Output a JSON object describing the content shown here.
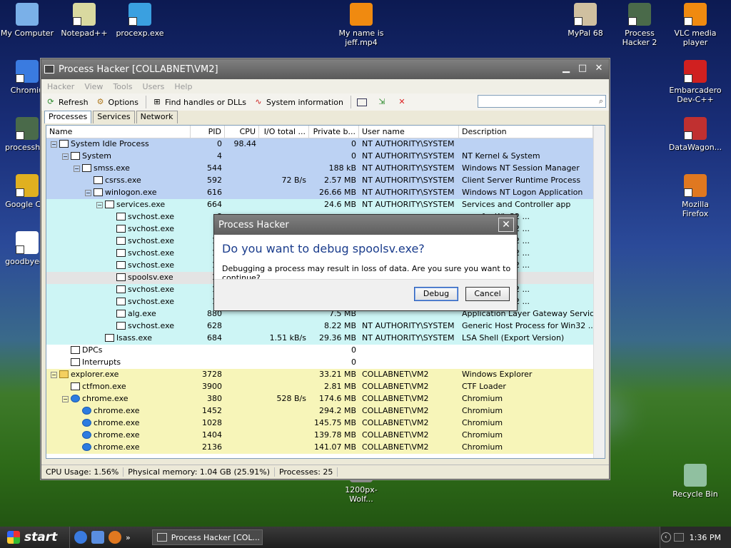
{
  "desktop_icons": [
    {
      "label": "My Computer",
      "icon": "computer-icon"
    },
    {
      "label": "Notepad++",
      "icon": "notepad-icon"
    },
    {
      "label": "procexp.exe",
      "icon": "procexp-icon"
    },
    {
      "label": "My name is jeff.mp4",
      "icon": "vlc-file-icon"
    },
    {
      "label": "MyPal 68",
      "icon": "mypal-icon"
    },
    {
      "label": "Process Hacker 2",
      "icon": "process-hacker-icon"
    },
    {
      "label": "VLC media player",
      "icon": "vlc-icon"
    },
    {
      "label": "Chromiu",
      "icon": "chromium-icon"
    },
    {
      "label": "Embarcadero Dev-C++",
      "icon": "devcpp-icon"
    },
    {
      "label": "processhac",
      "icon": "process-hacker-icon"
    },
    {
      "label": "DataWagon...",
      "icon": "datawagon-icon"
    },
    {
      "label": "Google Chr",
      "icon": "chrome-icon"
    },
    {
      "label": "Mozilla Firefox",
      "icon": "firefox-icon"
    },
    {
      "label": "goodbyedp",
      "icon": "file-icon"
    },
    {
      "label": "1200px-Wolf...",
      "icon": "image-icon"
    },
    {
      "label": "Recycle Bin",
      "icon": "recycle-bin-icon"
    }
  ],
  "window": {
    "title": "Process Hacker [COLLABNET\\VM2]",
    "menu": [
      "Hacker",
      "View",
      "Tools",
      "Users",
      "Help"
    ],
    "toolbar": {
      "refresh": "Refresh",
      "options": "Options",
      "find": "Find handles or DLLs",
      "sysinfo": "System information"
    },
    "tabs": [
      "Processes",
      "Services",
      "Network"
    ],
    "columns": [
      "Name",
      "PID",
      "CPU",
      "I/O total ...",
      "Private b...",
      "User name",
      "Description"
    ],
    "rows": [
      {
        "name": "System Idle Process",
        "pid": "0",
        "cpu": "98.44",
        "io": "",
        "priv": "0",
        "user": "NT AUTHORITY\\SYSTEM",
        "desc": "",
        "cls": "sys",
        "lvl": 0,
        "tog": "-"
      },
      {
        "name": "System",
        "pid": "4",
        "cpu": "",
        "io": "",
        "priv": "0",
        "user": "NT AUTHORITY\\SYSTEM",
        "desc": "NT Kernel & System",
        "cls": "sys",
        "lvl": 1,
        "tog": "-"
      },
      {
        "name": "smss.exe",
        "pid": "544",
        "cpu": "",
        "io": "",
        "priv": "188 kB",
        "user": "NT AUTHORITY\\SYSTEM",
        "desc": "Windows NT Session Manager",
        "cls": "sys",
        "lvl": 2,
        "tog": "-"
      },
      {
        "name": "csrss.exe",
        "pid": "592",
        "cpu": "",
        "io": "72 B/s",
        "priv": "2.57 MB",
        "user": "NT AUTHORITY\\SYSTEM",
        "desc": "Client Server Runtime Process",
        "cls": "sys",
        "lvl": 3,
        "tog": ""
      },
      {
        "name": "winlogon.exe",
        "pid": "616",
        "cpu": "",
        "io": "",
        "priv": "26.66 MB",
        "user": "NT AUTHORITY\\SYSTEM",
        "desc": "Windows NT Logon Application",
        "cls": "sys",
        "lvl": 3,
        "tog": "-"
      },
      {
        "name": "services.exe",
        "pid": "664",
        "cpu": "",
        "io": "",
        "priv": "24.6 MB",
        "user": "NT AUTHORITY\\SYSTEM",
        "desc": "Services and Controller app",
        "cls": "svc",
        "lvl": 4,
        "tog": "-"
      },
      {
        "name": "svchost.exe",
        "pid": "8",
        "cpu": "",
        "io": "",
        "priv": "",
        "user": "",
        "desc": "cess for Win32 ...",
        "cls": "svc",
        "lvl": 5,
        "tog": ""
      },
      {
        "name": "svchost.exe",
        "pid": "9",
        "cpu": "",
        "io": "",
        "priv": "",
        "user": "",
        "desc": "cess for Win32 ...",
        "cls": "svc",
        "lvl": 5,
        "tog": ""
      },
      {
        "name": "svchost.exe",
        "pid": "10",
        "cpu": "",
        "io": "",
        "priv": "",
        "user": "",
        "desc": "cess for Win32 ...",
        "cls": "svc",
        "lvl": 5,
        "tog": ""
      },
      {
        "name": "svchost.exe",
        "pid": "11",
        "cpu": "",
        "io": "",
        "priv": "",
        "user": "",
        "desc": "cess for Win32 ...",
        "cls": "svc",
        "lvl": 5,
        "tog": ""
      },
      {
        "name": "svchost.exe",
        "pid": "12",
        "cpu": "",
        "io": "",
        "priv": "",
        "user": "",
        "desc": "cess for Win32 ...",
        "cls": "svc",
        "lvl": 5,
        "tog": ""
      },
      {
        "name": "spoolsv.exe",
        "pid": "13",
        "cpu": "",
        "io": "",
        "priv": "",
        "user": "",
        "desc": "em App",
        "cls": "grey",
        "lvl": 5,
        "tog": ""
      },
      {
        "name": "svchost.exe",
        "pid": "15",
        "cpu": "",
        "io": "",
        "priv": "",
        "user": "",
        "desc": "cess for Win32 ...",
        "cls": "svc",
        "lvl": 5,
        "tog": ""
      },
      {
        "name": "svchost.exe",
        "pid": "16",
        "cpu": "",
        "io": "",
        "priv": "",
        "user": "",
        "desc": "cess for Win32 ...",
        "cls": "svc",
        "lvl": 5,
        "tog": ""
      },
      {
        "name": "alg.exe",
        "pid": "880",
        "cpu": "",
        "io": "",
        "priv": "7.5 MB",
        "user": "",
        "desc": "Application Layer Gateway Service",
        "cls": "svc",
        "lvl": 5,
        "tog": ""
      },
      {
        "name": "svchost.exe",
        "pid": "628",
        "cpu": "",
        "io": "",
        "priv": "8.22 MB",
        "user": "NT AUTHORITY\\SYSTEM",
        "desc": "Generic Host Process for Win32 ...",
        "cls": "svc",
        "lvl": 5,
        "tog": ""
      },
      {
        "name": "lsass.exe",
        "pid": "684",
        "cpu": "",
        "io": "1.51 kB/s",
        "priv": "29.36 MB",
        "user": "NT AUTHORITY\\SYSTEM",
        "desc": "LSA Shell (Export Version)",
        "cls": "svc",
        "lvl": 4,
        "tog": ""
      },
      {
        "name": "DPCs",
        "pid": "",
        "cpu": "",
        "io": "",
        "priv": "0",
        "user": "",
        "desc": "",
        "cls": "plain",
        "lvl": 1,
        "tog": ""
      },
      {
        "name": "Interrupts",
        "pid": "",
        "cpu": "",
        "io": "",
        "priv": "0",
        "user": "",
        "desc": "",
        "cls": "plain",
        "lvl": 1,
        "tog": ""
      },
      {
        "name": "explorer.exe",
        "pid": "3728",
        "cpu": "",
        "io": "",
        "priv": "33.21 MB",
        "user": "COLLABNET\\VM2",
        "desc": "Windows Explorer",
        "cls": "usr",
        "lvl": 0,
        "tog": "-",
        "ic": "folder"
      },
      {
        "name": "ctfmon.exe",
        "pid": "3900",
        "cpu": "",
        "io": "",
        "priv": "2.81 MB",
        "user": "COLLABNET\\VM2",
        "desc": "CTF Loader",
        "cls": "usr",
        "lvl": 1,
        "tog": ""
      },
      {
        "name": "chrome.exe",
        "pid": "380",
        "cpu": "",
        "io": "528 B/s",
        "priv": "174.6 MB",
        "user": "COLLABNET\\VM2",
        "desc": "Chromium",
        "cls": "usr",
        "lvl": 1,
        "tog": "-",
        "ic": "chrome"
      },
      {
        "name": "chrome.exe",
        "pid": "1452",
        "cpu": "",
        "io": "",
        "priv": "294.2 MB",
        "user": "COLLABNET\\VM2",
        "desc": "Chromium",
        "cls": "usr",
        "lvl": 2,
        "tog": "",
        "ic": "chrome"
      },
      {
        "name": "chrome.exe",
        "pid": "1028",
        "cpu": "",
        "io": "",
        "priv": "145.75 MB",
        "user": "COLLABNET\\VM2",
        "desc": "Chromium",
        "cls": "usr",
        "lvl": 2,
        "tog": "",
        "ic": "chrome"
      },
      {
        "name": "chrome.exe",
        "pid": "1404",
        "cpu": "",
        "io": "",
        "priv": "139.78 MB",
        "user": "COLLABNET\\VM2",
        "desc": "Chromium",
        "cls": "usr",
        "lvl": 2,
        "tog": "",
        "ic": "chrome"
      },
      {
        "name": "chrome.exe",
        "pid": "2136",
        "cpu": "",
        "io": "",
        "priv": "141.07 MB",
        "user": "COLLABNET\\VM2",
        "desc": "Chromium",
        "cls": "usr",
        "lvl": 2,
        "tog": "",
        "ic": "chrome"
      }
    ],
    "status": {
      "cpu": "CPU Usage: 1.56%",
      "mem": "Physical memory: 1.04 GB (25.91%)",
      "procs": "Processes: 25"
    }
  },
  "dialog": {
    "title": "Process Hacker",
    "question": "Do you want to debug spoolsv.exe?",
    "message": "Debugging a process may result in loss of data. Are you sure you want to continue?",
    "debug": "Debug",
    "cancel": "Cancel"
  },
  "taskbar": {
    "start": "start",
    "task": "Process Hacker [COL...",
    "clock": "1:36 PM"
  }
}
